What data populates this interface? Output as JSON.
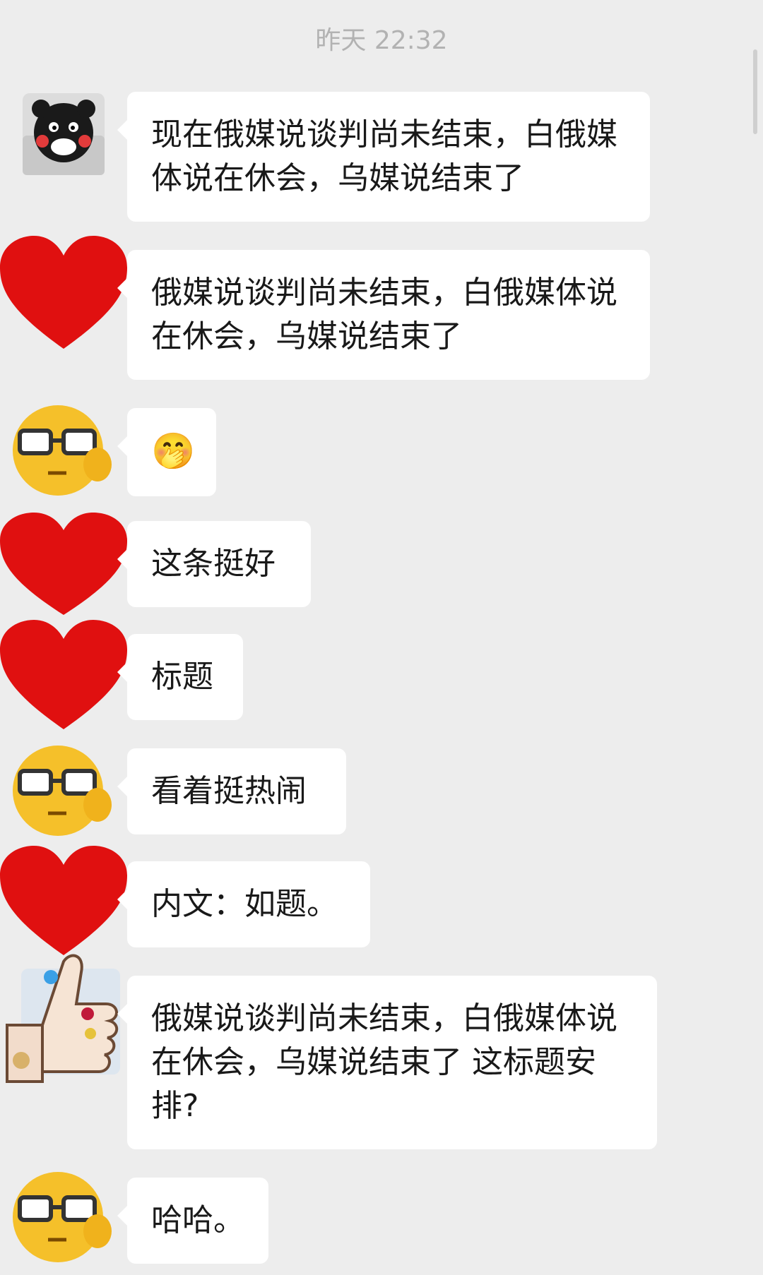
{
  "timestamp": "昨天 22:32",
  "messages": [
    {
      "avatar": "bear-avatar",
      "text": "现在俄媒说谈判尚未结束，白俄媒体说在休会，乌媒说结束了"
    },
    {
      "avatar": "red-heart-avatar",
      "text": "俄媒说谈判尚未结束，白俄媒体说在休会，乌媒说结束了"
    },
    {
      "avatar": "glasses-emoji-avatar",
      "text": "🤭"
    },
    {
      "avatar": "red-heart-avatar",
      "text": "这条挺好"
    },
    {
      "avatar": "red-heart-avatar",
      "text": "标题"
    },
    {
      "avatar": "glasses-emoji-avatar",
      "text": "看着挺热闹"
    },
    {
      "avatar": "red-heart-avatar",
      "text": "内文：如题。"
    },
    {
      "avatar": "thumbs-up-avatar",
      "text": "俄媒说谈判尚未结束，白俄媒体说在休会，乌媒说结束了 这标题安排?"
    },
    {
      "avatar": "glasses-emoji-avatar",
      "text": "哈哈。"
    }
  ]
}
